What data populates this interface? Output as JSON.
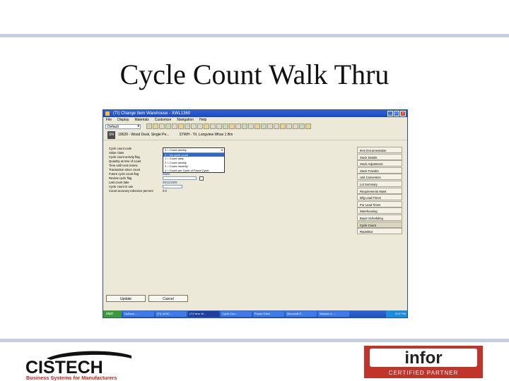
{
  "slide": {
    "title": "Cycle Count Walk Thru"
  },
  "window": {
    "title": "(TI) Change Item Warehouse - XWL1360",
    "menu": [
      "File",
      "Display",
      "Materials",
      "Customize",
      "Navigation",
      "Help"
    ],
    "toolbar_combo": "Default",
    "header": {
      "item_text": "10620 - Wood Desk, Single Pe...",
      "whse_text": "STWH - Trl, Longview Whse 1 Bm"
    },
    "form_rows": [
      {
        "label": "Cycle count code",
        "value": ""
      },
      {
        "label": "Value class",
        "value": ""
      },
      {
        "label": "Cycle count activity flag",
        "value": ""
      },
      {
        "label": "Quantity at time of count",
        "value": ""
      },
      {
        "label": "Time until next review",
        "value": ""
      },
      {
        "label": "Transaction since count",
        "value": "0"
      },
      {
        "label": "Future cycle count flag",
        "value": "Blank"
      },
      {
        "label": "Review cycle flag",
        "value": ""
      },
      {
        "label": "Last count date",
        "value": "09/11/2006"
      },
      {
        "label": "Cycle count in use",
        "value": ""
      },
      {
        "label": "Count accuracy tolerance percent",
        "value": "0.0"
      }
    ],
    "dropdown": {
      "selected": "3 = Count weekly",
      "options": [
        "0 = No cycle count",
        "1 = Count daily",
        "2 = Count weekly",
        "3 = Count monthly",
        "4 = Count per Cycle of Fiscal Cycle"
      ]
    },
    "right_panel": [
      "Item Documentation",
      "Stock Details",
      "Stock Adjustment",
      "Stock Transfer",
      "Unit Conversion",
      "Lot Summary",
      "Requirements Maint",
      "Mfg Lead Times",
      "Pur Lead Times",
      "Warehousing",
      "Buyer Scheduling",
      "Cycle Count",
      "Repetitive"
    ],
    "buttons": {
      "update": "Update",
      "cancel": "Cancel"
    },
    "taskbar": {
      "start": "start",
      "tasks": [
        "Outlook - ...",
        "(TI) XLRC ...",
        "(TI) Item W...",
        "Cycle Cou...",
        "Power Point",
        "Microsoft P...",
        "Session A - ...",
        "Session A - ..."
      ],
      "clock": "9:07 PM"
    }
  },
  "logos": {
    "cistech": {
      "name": "CISTECH",
      "tagline": "Business Systems for Manufacturers"
    },
    "infor": {
      "name": "infor",
      "sub": "CERTIFIED PARTNER"
    }
  },
  "colors": {
    "rule": "#c5cfe0",
    "xp_title": "#2e63d8",
    "cistech_red": "#cc1f1f",
    "infor_red": "#c0342a"
  }
}
